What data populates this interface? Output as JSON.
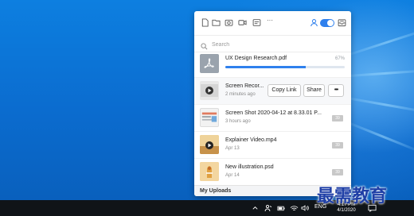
{
  "toolbar": {
    "icons": [
      "file-icon",
      "folder-icon",
      "screenshot-icon",
      "video-record-icon",
      "annotate-icon",
      "more-icon",
      "user-icon",
      "toggle-switch",
      "inbox-icon"
    ],
    "more_label": "···"
  },
  "search": {
    "placeholder": "Search",
    "value": ""
  },
  "items": [
    {
      "title": "UX Design Research.pdf",
      "percent": "67%",
      "progress": 0.67,
      "kind": "pdf"
    },
    {
      "title": "Screen Recor...",
      "subtitle": "2 minutes ago",
      "kind": "video",
      "actions": {
        "copy_link": "Copy Link",
        "share": "Share",
        "more": "•••"
      }
    },
    {
      "title": "Screen Shot 2020-04-12 at 8.33.01 P...",
      "subtitle": "3 hours ago",
      "kind": "image",
      "badge": "39"
    },
    {
      "title": "Explainer Video.mp4",
      "subtitle": "Apr 13",
      "kind": "video",
      "badge": "39"
    },
    {
      "title": "New illustration.psd",
      "subtitle": "Apr 14",
      "kind": "psd",
      "badge": "39"
    }
  ],
  "footer": {
    "label": "My Uploads"
  },
  "taskbar": {
    "language": "ENG",
    "time": "4:17 PM",
    "date": "4/1/2020",
    "tray_icons": [
      "chevron-up-icon",
      "people-icon",
      "battery-icon",
      "wifi-icon",
      "volume-icon",
      "notification-icon"
    ]
  },
  "watermark": {
    "text": "最需教育"
  },
  "colors": {
    "accent": "#2f80ed",
    "desktop": "#0b6ccf",
    "taskbar": "#101418"
  }
}
